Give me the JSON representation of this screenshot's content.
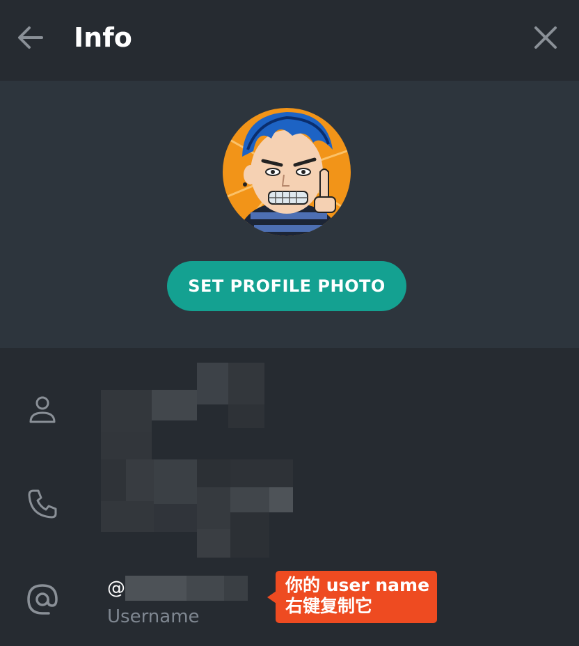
{
  "header": {
    "title": "Info",
    "back_icon": "arrow-left-icon",
    "close_icon": "close-icon"
  },
  "profile": {
    "avatar_icon": "cartoon-avatar",
    "set_photo_label": "SET PROFILE PHOTO",
    "accent_color": "#14a191"
  },
  "fields": {
    "name_icon": "person-icon",
    "phone_icon": "phone-icon",
    "username_icon": "at-sign-icon",
    "username_prefix": "@",
    "username_label": "Username"
  },
  "annotation": {
    "line1": "你的 user name",
    "line2": "右键复制它",
    "color": "#ee4b21"
  }
}
